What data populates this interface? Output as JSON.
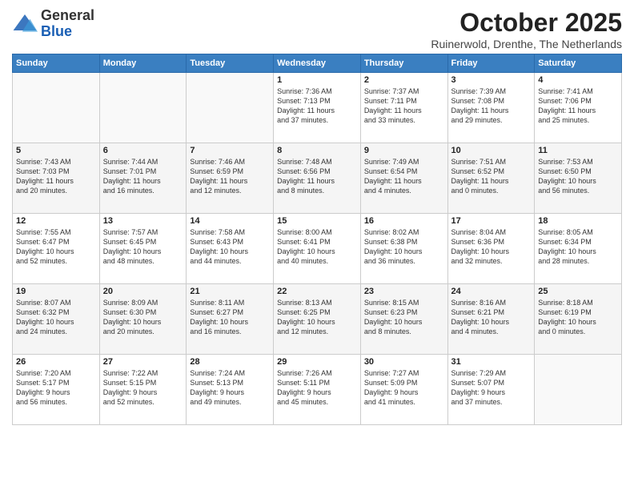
{
  "header": {
    "logo_general": "General",
    "logo_blue": "Blue",
    "title": "October 2025",
    "location": "Ruinerwold, Drenthe, The Netherlands"
  },
  "weekdays": [
    "Sunday",
    "Monday",
    "Tuesday",
    "Wednesday",
    "Thursday",
    "Friday",
    "Saturday"
  ],
  "weeks": [
    [
      {
        "day": "",
        "info": ""
      },
      {
        "day": "",
        "info": ""
      },
      {
        "day": "",
        "info": ""
      },
      {
        "day": "1",
        "info": "Sunrise: 7:36 AM\nSunset: 7:13 PM\nDaylight: 11 hours\nand 37 minutes."
      },
      {
        "day": "2",
        "info": "Sunrise: 7:37 AM\nSunset: 7:11 PM\nDaylight: 11 hours\nand 33 minutes."
      },
      {
        "day": "3",
        "info": "Sunrise: 7:39 AM\nSunset: 7:08 PM\nDaylight: 11 hours\nand 29 minutes."
      },
      {
        "day": "4",
        "info": "Sunrise: 7:41 AM\nSunset: 7:06 PM\nDaylight: 11 hours\nand 25 minutes."
      }
    ],
    [
      {
        "day": "5",
        "info": "Sunrise: 7:43 AM\nSunset: 7:03 PM\nDaylight: 11 hours\nand 20 minutes."
      },
      {
        "day": "6",
        "info": "Sunrise: 7:44 AM\nSunset: 7:01 PM\nDaylight: 11 hours\nand 16 minutes."
      },
      {
        "day": "7",
        "info": "Sunrise: 7:46 AM\nSunset: 6:59 PM\nDaylight: 11 hours\nand 12 minutes."
      },
      {
        "day": "8",
        "info": "Sunrise: 7:48 AM\nSunset: 6:56 PM\nDaylight: 11 hours\nand 8 minutes."
      },
      {
        "day": "9",
        "info": "Sunrise: 7:49 AM\nSunset: 6:54 PM\nDaylight: 11 hours\nand 4 minutes."
      },
      {
        "day": "10",
        "info": "Sunrise: 7:51 AM\nSunset: 6:52 PM\nDaylight: 11 hours\nand 0 minutes."
      },
      {
        "day": "11",
        "info": "Sunrise: 7:53 AM\nSunset: 6:50 PM\nDaylight: 10 hours\nand 56 minutes."
      }
    ],
    [
      {
        "day": "12",
        "info": "Sunrise: 7:55 AM\nSunset: 6:47 PM\nDaylight: 10 hours\nand 52 minutes."
      },
      {
        "day": "13",
        "info": "Sunrise: 7:57 AM\nSunset: 6:45 PM\nDaylight: 10 hours\nand 48 minutes."
      },
      {
        "day": "14",
        "info": "Sunrise: 7:58 AM\nSunset: 6:43 PM\nDaylight: 10 hours\nand 44 minutes."
      },
      {
        "day": "15",
        "info": "Sunrise: 8:00 AM\nSunset: 6:41 PM\nDaylight: 10 hours\nand 40 minutes."
      },
      {
        "day": "16",
        "info": "Sunrise: 8:02 AM\nSunset: 6:38 PM\nDaylight: 10 hours\nand 36 minutes."
      },
      {
        "day": "17",
        "info": "Sunrise: 8:04 AM\nSunset: 6:36 PM\nDaylight: 10 hours\nand 32 minutes."
      },
      {
        "day": "18",
        "info": "Sunrise: 8:05 AM\nSunset: 6:34 PM\nDaylight: 10 hours\nand 28 minutes."
      }
    ],
    [
      {
        "day": "19",
        "info": "Sunrise: 8:07 AM\nSunset: 6:32 PM\nDaylight: 10 hours\nand 24 minutes."
      },
      {
        "day": "20",
        "info": "Sunrise: 8:09 AM\nSunset: 6:30 PM\nDaylight: 10 hours\nand 20 minutes."
      },
      {
        "day": "21",
        "info": "Sunrise: 8:11 AM\nSunset: 6:27 PM\nDaylight: 10 hours\nand 16 minutes."
      },
      {
        "day": "22",
        "info": "Sunrise: 8:13 AM\nSunset: 6:25 PM\nDaylight: 10 hours\nand 12 minutes."
      },
      {
        "day": "23",
        "info": "Sunrise: 8:15 AM\nSunset: 6:23 PM\nDaylight: 10 hours\nand 8 minutes."
      },
      {
        "day": "24",
        "info": "Sunrise: 8:16 AM\nSunset: 6:21 PM\nDaylight: 10 hours\nand 4 minutes."
      },
      {
        "day": "25",
        "info": "Sunrise: 8:18 AM\nSunset: 6:19 PM\nDaylight: 10 hours\nand 0 minutes."
      }
    ],
    [
      {
        "day": "26",
        "info": "Sunrise: 7:20 AM\nSunset: 5:17 PM\nDaylight: 9 hours\nand 56 minutes."
      },
      {
        "day": "27",
        "info": "Sunrise: 7:22 AM\nSunset: 5:15 PM\nDaylight: 9 hours\nand 52 minutes."
      },
      {
        "day": "28",
        "info": "Sunrise: 7:24 AM\nSunset: 5:13 PM\nDaylight: 9 hours\nand 49 minutes."
      },
      {
        "day": "29",
        "info": "Sunrise: 7:26 AM\nSunset: 5:11 PM\nDaylight: 9 hours\nand 45 minutes."
      },
      {
        "day": "30",
        "info": "Sunrise: 7:27 AM\nSunset: 5:09 PM\nDaylight: 9 hours\nand 41 minutes."
      },
      {
        "day": "31",
        "info": "Sunrise: 7:29 AM\nSunset: 5:07 PM\nDaylight: 9 hours\nand 37 minutes."
      },
      {
        "day": "",
        "info": ""
      }
    ]
  ]
}
